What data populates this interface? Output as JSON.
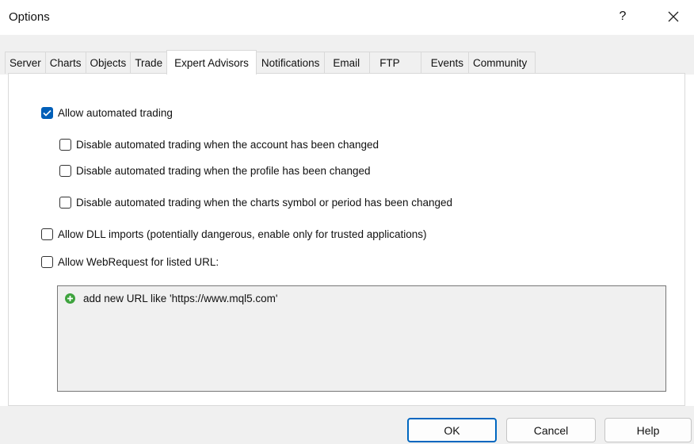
{
  "window": {
    "title": "Options",
    "help_label": "?"
  },
  "tabs": [
    {
      "label": "Server"
    },
    {
      "label": "Charts"
    },
    {
      "label": "Objects"
    },
    {
      "label": "Trade"
    },
    {
      "label": "Expert Advisors",
      "active": true
    },
    {
      "label": "Notifications"
    },
    {
      "label": "Email"
    },
    {
      "label": "FTP"
    },
    {
      "label": "Events"
    },
    {
      "label": "Community"
    }
  ],
  "options": {
    "allow_automated": {
      "label": "Allow automated trading",
      "checked": true
    },
    "disable_account": {
      "label": "Disable automated trading when the account has been changed",
      "checked": false
    },
    "disable_profile": {
      "label": "Disable automated trading when the profile has been changed",
      "checked": false
    },
    "disable_symbol": {
      "label": "Disable automated trading when the charts symbol or period has been changed",
      "checked": false
    },
    "allow_dll": {
      "label": "Allow DLL imports (potentially dangerous, enable only for trusted applications)",
      "checked": false
    },
    "allow_webrequest": {
      "label": "Allow WebRequest for listed URL:",
      "checked": false
    }
  },
  "url_list": {
    "add_label": "add new URL like 'https://www.mql5.com'"
  },
  "buttons": {
    "ok": "OK",
    "cancel": "Cancel",
    "help": "Help"
  },
  "colors": {
    "accent": "#005fb8",
    "add_icon": "#3ea33e"
  }
}
